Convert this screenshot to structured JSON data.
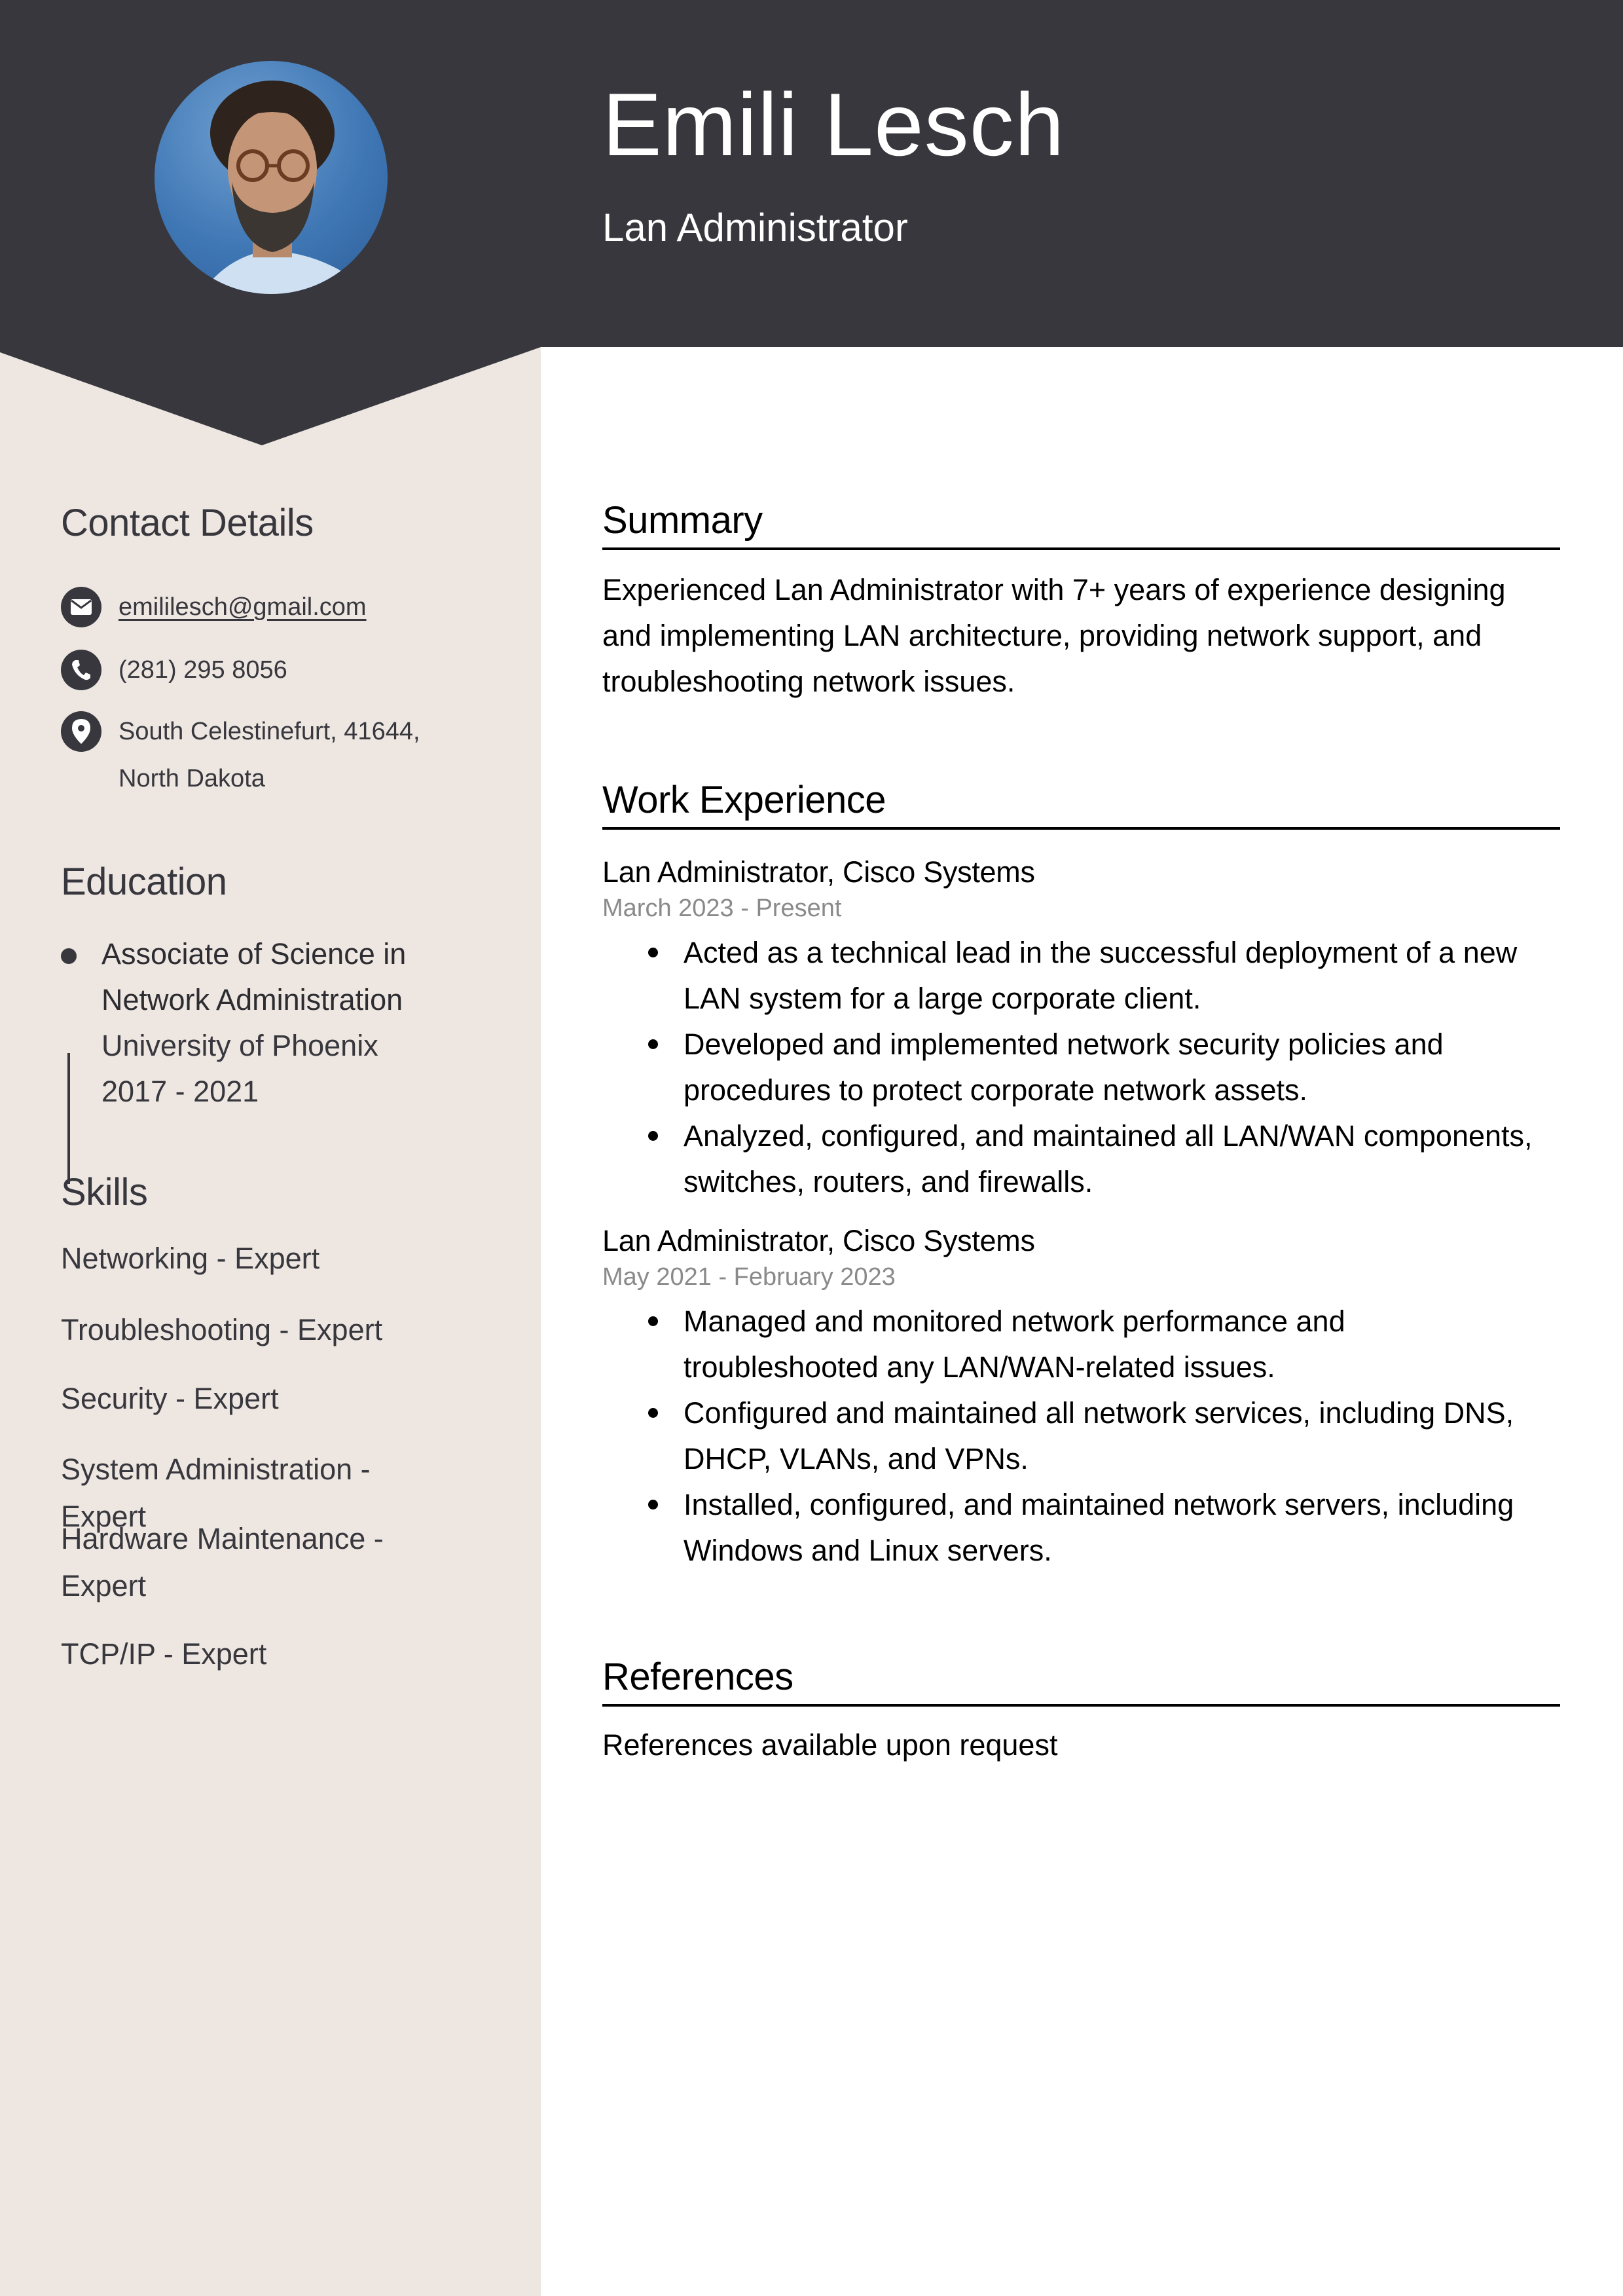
{
  "header": {
    "name": "Emili Lesch",
    "title": "Lan Administrator",
    "photo_alt": "Profile photo of Emili Lesch"
  },
  "colors": {
    "header_bg": "#37373d",
    "sidebar_bg": "#ede6e1",
    "text_dark": "#37373d",
    "date_gray": "#8a8a8a"
  },
  "sidebar": {
    "contact": {
      "heading": "Contact Details",
      "items": [
        {
          "icon": "envelope-icon",
          "text": "emililesch@gmail.com"
        },
        {
          "icon": "phone-icon",
          "text": "(281) 295 8056"
        },
        {
          "icon": "location-pin-icon",
          "line1": "South Celestinefurt, 41644,",
          "line2": "North Dakota"
        }
      ]
    },
    "education": {
      "heading": "Education",
      "entries": [
        {
          "degree_line1": "Associate of Science in",
          "degree_line2": "Network Administration",
          "school": "University of Phoenix",
          "years": "2017 - 2021"
        }
      ]
    },
    "skills": {
      "heading": "Skills",
      "items": [
        "Networking - Expert",
        "Troubleshooting - Expert",
        "Security - Expert",
        "System Administration - Expert",
        {
          "line1": "Hardware Maintenance -",
          "line2": "Expert"
        },
        "TCP/IP - Expert"
      ]
    }
  },
  "main": {
    "summary": {
      "heading": "Summary",
      "lines": [
        "Experienced Lan Administrator with 7+ years of experience designing",
        "and implementing LAN architecture, providing network support, and",
        "troubleshooting network issues."
      ]
    },
    "experience": {
      "heading": "Work Experience",
      "jobs": [
        {
          "title": "Lan Administrator, Cisco Systems",
          "dates": "March 2023 - Present",
          "bullets": [
            [
              "Acted as a technical lead in the successful deployment of a new",
              "LAN system for a large corporate client."
            ],
            [
              "Developed and implemented network security policies and",
              "procedures to protect corporate network assets."
            ],
            [
              "Analyzed, configured, and maintained all LAN/WAN components,",
              "switches, routers, and firewalls."
            ]
          ]
        },
        {
          "title": "Lan Administrator, Cisco Systems",
          "dates": "May 2021 - February 2023",
          "bullets": [
            [
              "Managed and monitored network performance and",
              "troubleshooted any LAN/WAN-related issues."
            ],
            [
              "Configured and maintained all network services, including DNS,",
              "DHCP, VLANs, and VPNs."
            ],
            [
              "Installed, configured, and maintained network servers, including",
              "Windows and Linux servers."
            ]
          ]
        }
      ]
    },
    "references": {
      "heading": "References",
      "text": "References available upon request"
    }
  }
}
